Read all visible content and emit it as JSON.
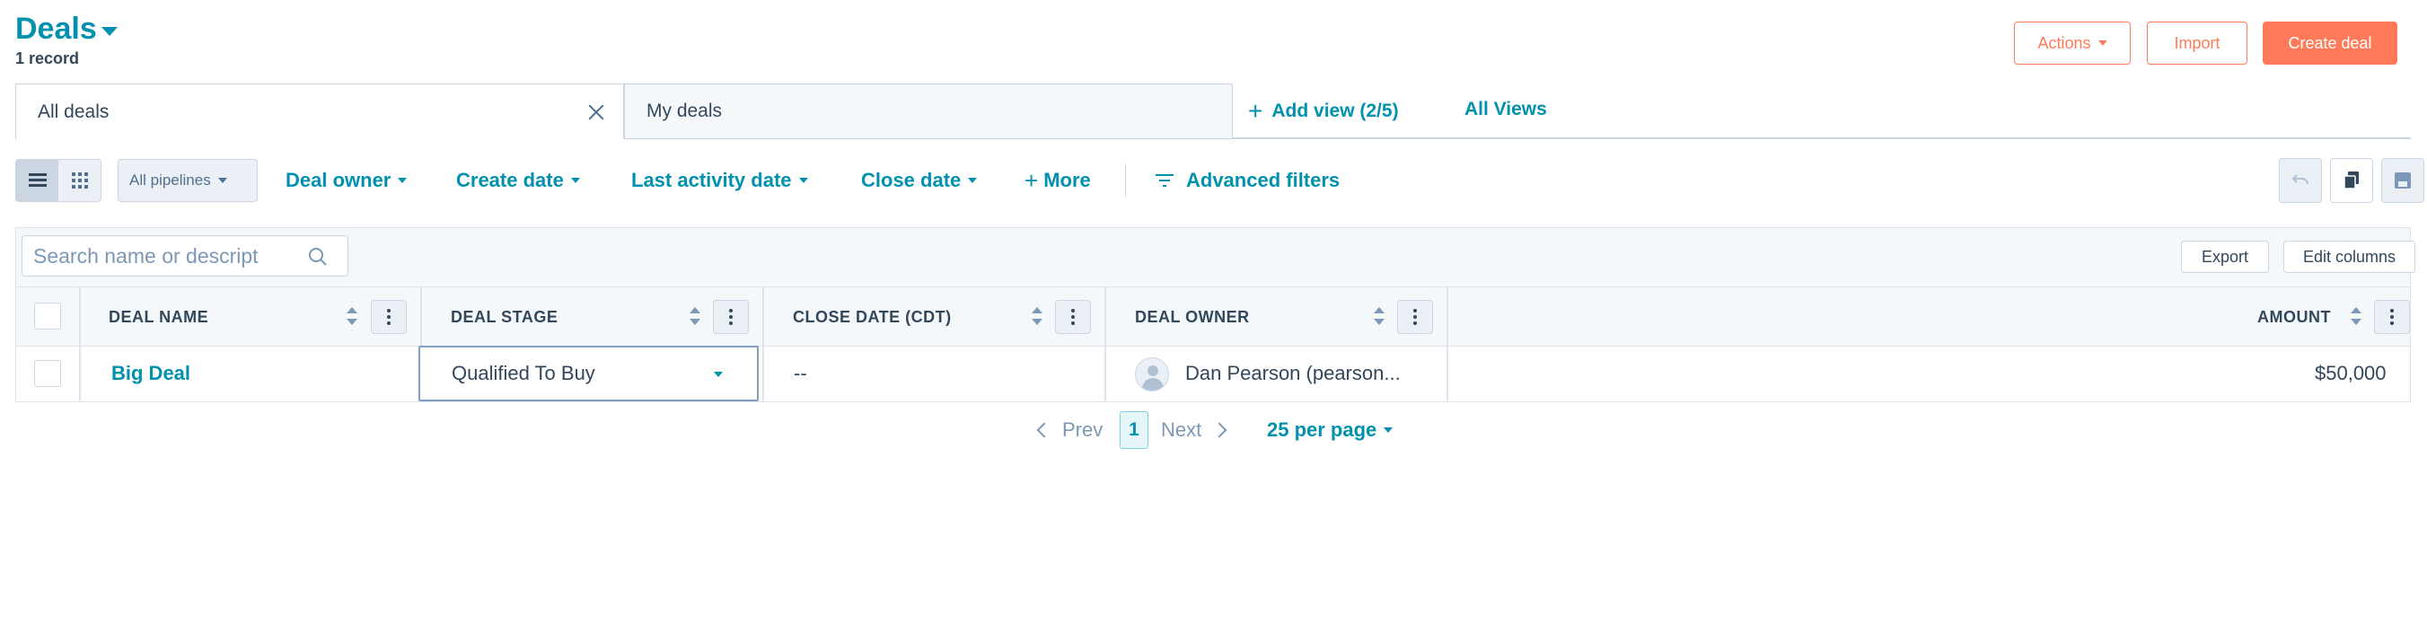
{
  "header": {
    "title": "Deals",
    "record_count": "1 record",
    "actions_label": "Actions",
    "import_label": "Import",
    "create_label": "Create deal"
  },
  "tabs": [
    {
      "label": "All deals",
      "active": true
    },
    {
      "label": "My deals",
      "active": false
    }
  ],
  "tab_links": {
    "add_view": "Add view (2/5)",
    "all_views": "All Views"
  },
  "filters": {
    "pipelines": "All pipelines",
    "deal_owner": "Deal owner",
    "create_date": "Create date",
    "last_activity": "Last activity date",
    "close_date": "Close date",
    "more": "More",
    "advanced": "Advanced filters"
  },
  "table_toolbar": {
    "search_placeholder": "Search name or descript",
    "export": "Export",
    "edit_columns": "Edit columns"
  },
  "columns": [
    "DEAL NAME",
    "DEAL STAGE",
    "CLOSE DATE (CDT)",
    "DEAL OWNER",
    "AMOUNT"
  ],
  "rows": [
    {
      "deal_name": "Big Deal",
      "deal_stage": "Qualified To Buy",
      "close_date": "--",
      "deal_owner": "Dan Pearson (pearson...",
      "amount": "$50,000"
    }
  ],
  "pagination": {
    "prev": "Prev",
    "page": "1",
    "next": "Next",
    "per_page": "25 per page"
  },
  "colors": {
    "accent": "#0091ae",
    "primary_button": "#ff7a59",
    "text": "#33475b",
    "border": "#cbd6e2"
  }
}
